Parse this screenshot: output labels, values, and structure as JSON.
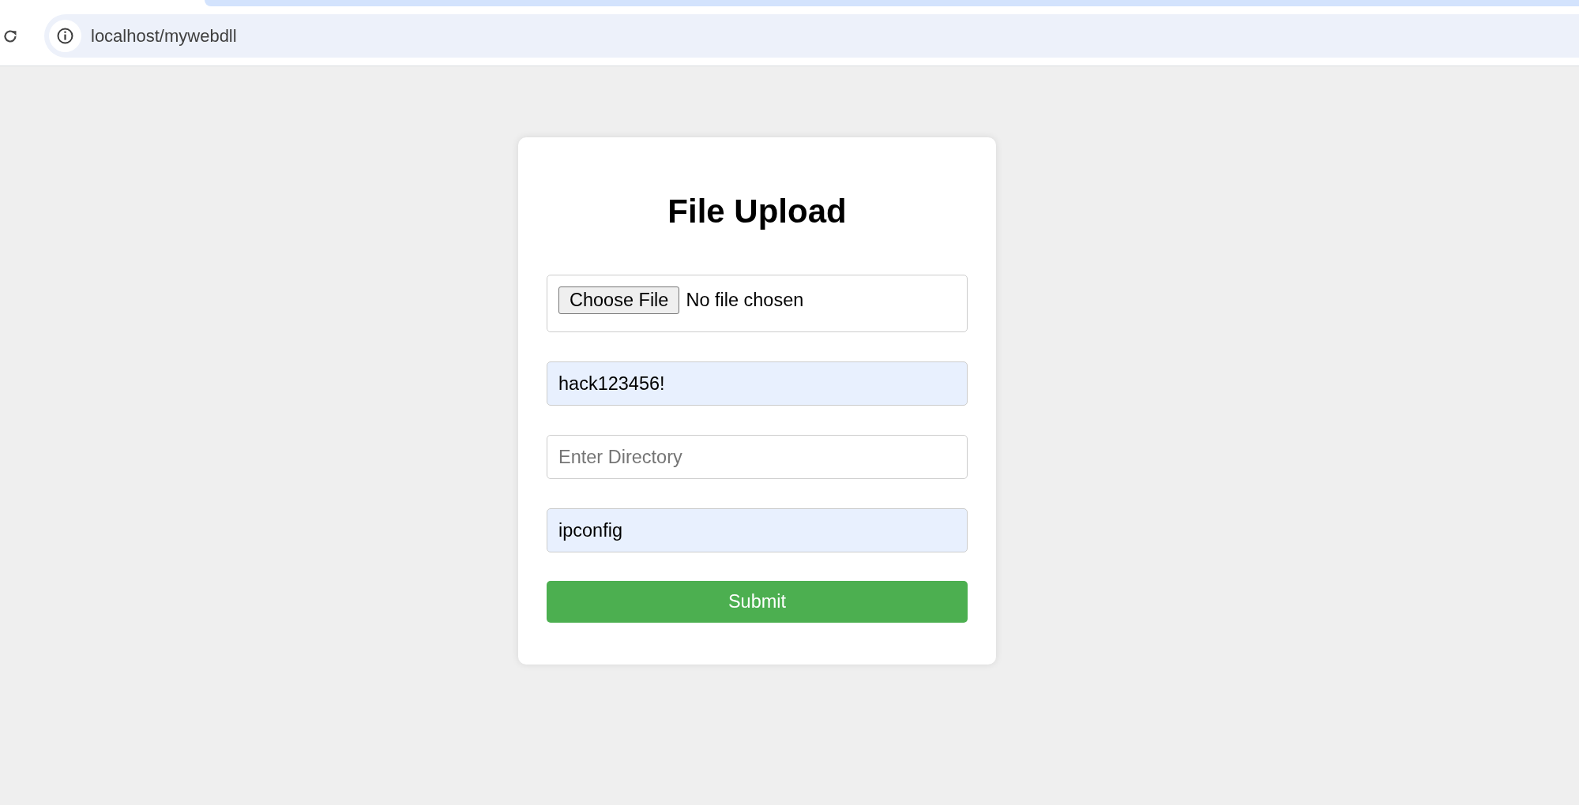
{
  "browser": {
    "url": "localhost/mywebdll"
  },
  "form": {
    "title": "File Upload",
    "fields": [
      {
        "kind": "file",
        "button": "Choose File",
        "status": "No file chosen"
      },
      {
        "kind": "text",
        "value": "hack123456!",
        "autofilled": true
      },
      {
        "kind": "text",
        "placeholder": "Enter Directory",
        "autofilled": false
      },
      {
        "kind": "text",
        "value": "ipconfig",
        "autofilled": true
      }
    ],
    "submit": "Submit"
  }
}
